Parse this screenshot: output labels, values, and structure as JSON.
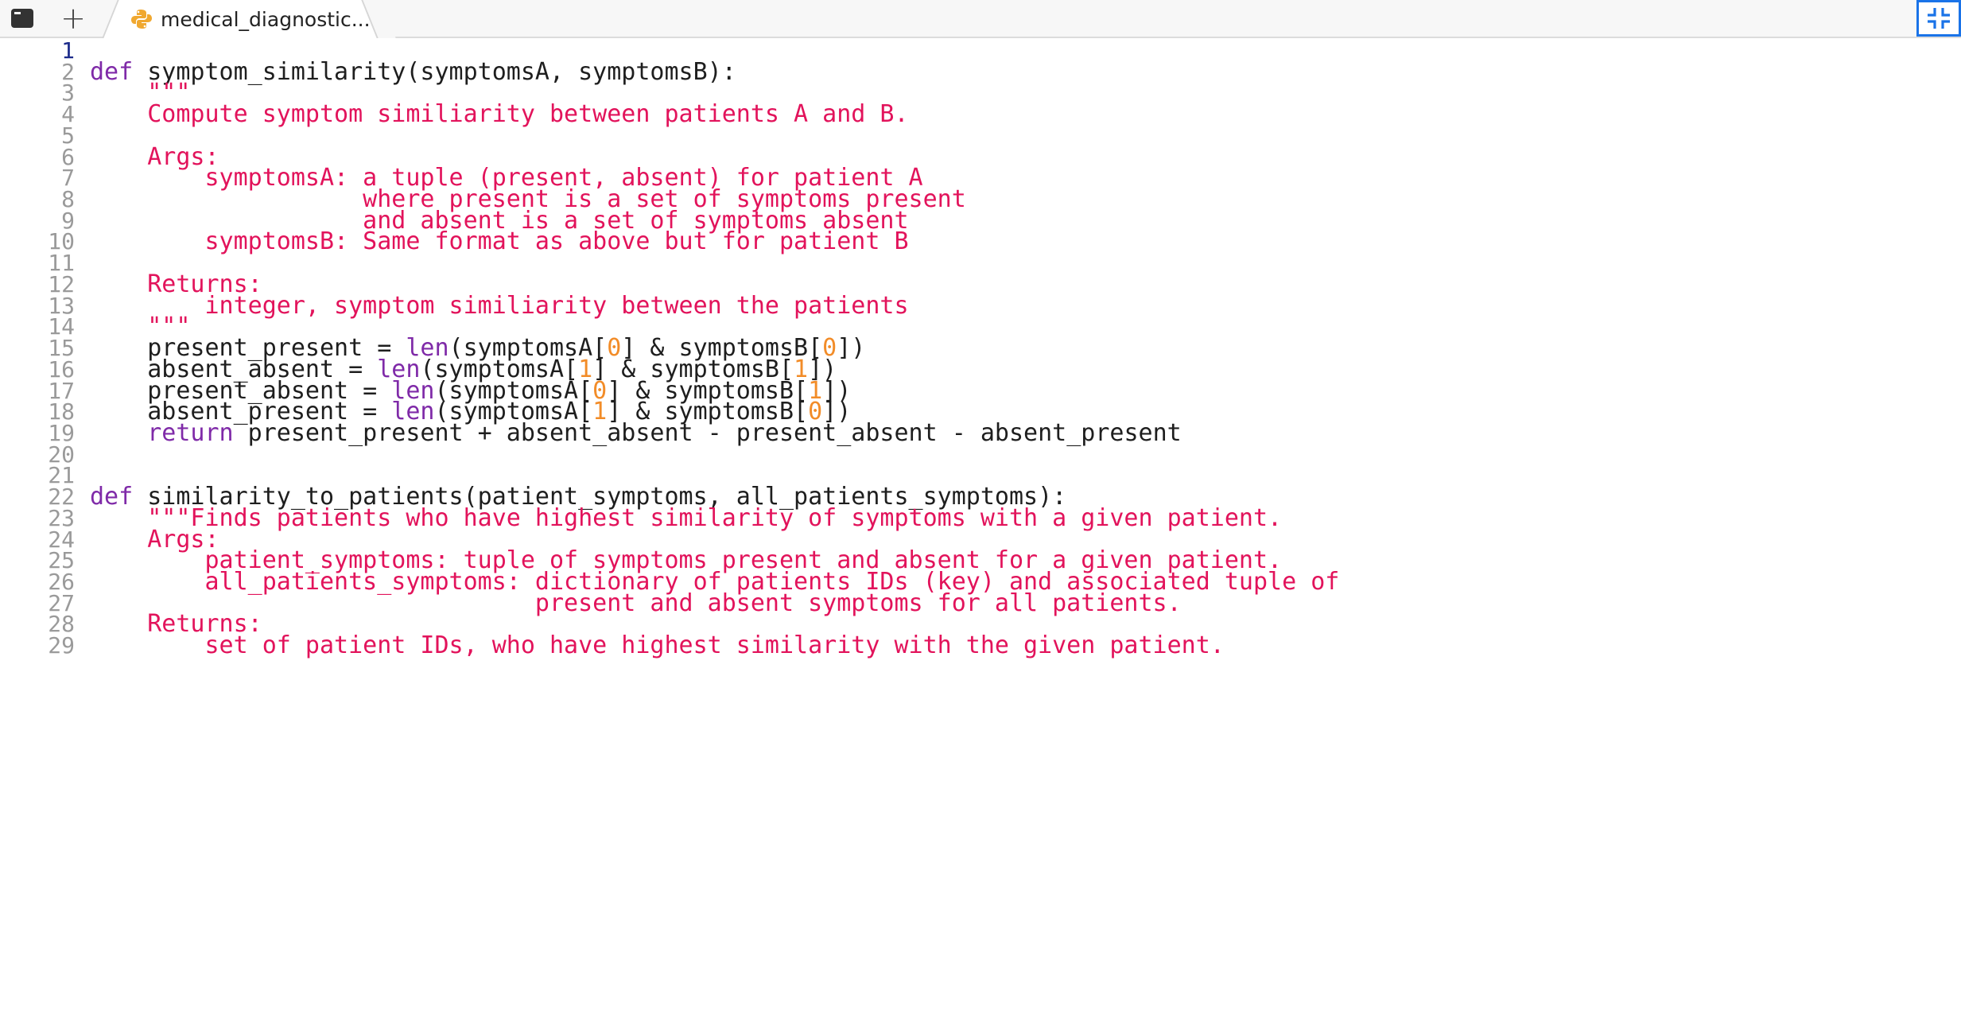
{
  "tabbar": {
    "new_tab_label": "+",
    "active_tab_title": "medical_diagnostic....",
    "icons": {
      "terminal": "terminal-icon",
      "python": "python-file-icon",
      "collapse": "collapse-icon"
    }
  },
  "editor": {
    "active_line": 1,
    "lines": [
      {
        "n": "1",
        "segments": []
      },
      {
        "n": "2",
        "segments": [
          [
            "kw",
            "def"
          ],
          [
            "p",
            " symptom_similarity(symptomsA, symptomsB):"
          ]
        ]
      },
      {
        "n": "3",
        "segments": [
          [
            "p",
            "    "
          ],
          [
            "str",
            "\"\"\""
          ]
        ]
      },
      {
        "n": "4",
        "segments": [
          [
            "str",
            "    Compute symptom similiarity between patients A and B."
          ]
        ]
      },
      {
        "n": "5",
        "segments": []
      },
      {
        "n": "6",
        "segments": [
          [
            "str",
            "    Args:"
          ]
        ]
      },
      {
        "n": "7",
        "segments": [
          [
            "str",
            "        symptomsA: a tuple (present, absent) for patient A"
          ]
        ]
      },
      {
        "n": "8",
        "segments": [
          [
            "str",
            "                   where present is a set of symptoms present"
          ]
        ]
      },
      {
        "n": "9",
        "segments": [
          [
            "str",
            "                   and absent is a set of symptoms absent"
          ]
        ]
      },
      {
        "n": "10",
        "segments": [
          [
            "str",
            "        symptomsB: Same format as above but for patient B"
          ]
        ]
      },
      {
        "n": "11",
        "segments": []
      },
      {
        "n": "12",
        "segments": [
          [
            "str",
            "    Returns:"
          ]
        ]
      },
      {
        "n": "13",
        "segments": [
          [
            "str",
            "        integer, symptom similiarity between the patients"
          ]
        ]
      },
      {
        "n": "14",
        "segments": [
          [
            "str",
            "    \"\"\""
          ]
        ]
      },
      {
        "n": "15",
        "segments": [
          [
            "p",
            "    present_present = "
          ],
          [
            "bi",
            "len"
          ],
          [
            "p",
            "(symptomsA["
          ],
          [
            "num",
            "0"
          ],
          [
            "p",
            "] & symptomsB["
          ],
          [
            "num",
            "0"
          ],
          [
            "p",
            "])"
          ]
        ]
      },
      {
        "n": "16",
        "segments": [
          [
            "p",
            "    absent_absent = "
          ],
          [
            "bi",
            "len"
          ],
          [
            "p",
            "(symptomsA["
          ],
          [
            "num",
            "1"
          ],
          [
            "p",
            "] & symptomsB["
          ],
          [
            "num",
            "1"
          ],
          [
            "p",
            "])"
          ]
        ]
      },
      {
        "n": "17",
        "segments": [
          [
            "p",
            "    present_absent = "
          ],
          [
            "bi",
            "len"
          ],
          [
            "p",
            "(symptomsA["
          ],
          [
            "num",
            "0"
          ],
          [
            "p",
            "] & symptomsB["
          ],
          [
            "num",
            "1"
          ],
          [
            "p",
            "])"
          ]
        ]
      },
      {
        "n": "18",
        "segments": [
          [
            "p",
            "    absent_present = "
          ],
          [
            "bi",
            "len"
          ],
          [
            "p",
            "(symptomsA["
          ],
          [
            "num",
            "1"
          ],
          [
            "p",
            "] & symptomsB["
          ],
          [
            "num",
            "0"
          ],
          [
            "p",
            "])"
          ]
        ]
      },
      {
        "n": "19",
        "segments": [
          [
            "p",
            "    "
          ],
          [
            "kw",
            "return"
          ],
          [
            "p",
            " present_present + absent_absent - present_absent - absent_present"
          ]
        ]
      },
      {
        "n": "20",
        "segments": []
      },
      {
        "n": "21",
        "segments": []
      },
      {
        "n": "22",
        "segments": [
          [
            "kw",
            "def"
          ],
          [
            "p",
            " similarity_to_patients(patient_symptoms, all_patients_symptoms):"
          ]
        ]
      },
      {
        "n": "23",
        "segments": [
          [
            "str",
            "    \"\"\"Finds patients who have highest similarity of symptoms with a given patient."
          ]
        ]
      },
      {
        "n": "24",
        "segments": [
          [
            "str",
            "    Args:"
          ]
        ]
      },
      {
        "n": "25",
        "segments": [
          [
            "str",
            "        patient_symptoms: tuple of symptoms present and absent for a given patient."
          ]
        ]
      },
      {
        "n": "26",
        "segments": [
          [
            "str",
            "        all_patients_symptoms: dictionary of patients IDs (key) and associated tuple of"
          ]
        ]
      },
      {
        "n": "27",
        "segments": [
          [
            "str",
            "                               present and absent symptoms for all patients."
          ]
        ]
      },
      {
        "n": "28",
        "segments": [
          [
            "str",
            "    Returns:"
          ]
        ]
      },
      {
        "n": "29",
        "segments": [
          [
            "str",
            "        set of patient IDs, who have highest similarity with the given patient."
          ]
        ]
      }
    ]
  },
  "colors": {
    "keyword": "#7f2aa8",
    "string": "#e2135b",
    "number": "#f28c28",
    "plain": "#1e1e1e",
    "line_number": "#9a9a9a",
    "active_line_number": "#1b2a8a",
    "accent": "#1a73e8"
  }
}
